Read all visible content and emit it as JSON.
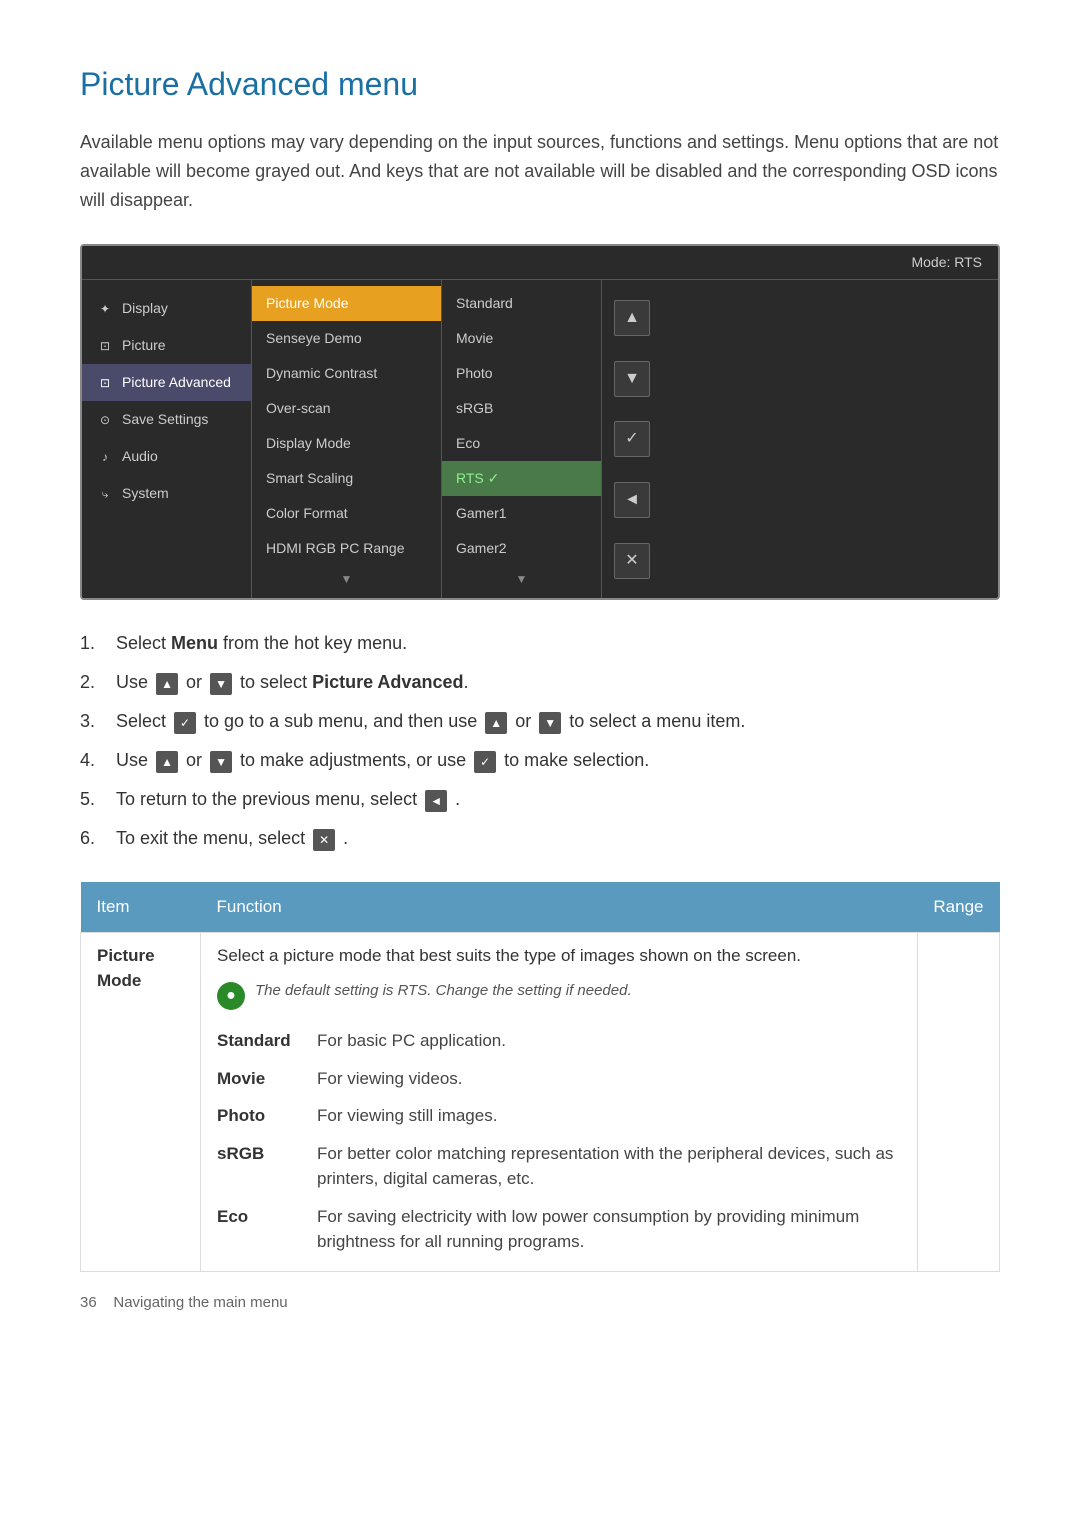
{
  "page": {
    "title": "Picture Advanced menu",
    "intro": "Available menu options may vary depending on the input sources, functions and settings. Menu options that are not available will become grayed out. And keys that are not available will be disabled and the corresponding OSD icons will disappear."
  },
  "osd": {
    "mode_label": "Mode: RTS",
    "sidebar_items": [
      {
        "label": "Display",
        "icon": "✦",
        "active": false
      },
      {
        "label": "Picture",
        "icon": "⊡",
        "active": false
      },
      {
        "label": "Picture Advanced",
        "icon": "⊡",
        "active": true
      },
      {
        "label": "Save Settings",
        "icon": "⊙",
        "active": false
      },
      {
        "label": "Audio",
        "icon": "♪",
        "active": false
      },
      {
        "label": "System",
        "icon": "⤷",
        "active": false
      }
    ],
    "menu_items": [
      {
        "label": "Picture Mode",
        "highlighted": true
      },
      {
        "label": "Senseye Demo",
        "highlighted": false
      },
      {
        "label": "Dynamic Contrast",
        "highlighted": false
      },
      {
        "label": "Over-scan",
        "highlighted": false
      },
      {
        "label": "Display Mode",
        "highlighted": false
      },
      {
        "label": "Smart Scaling",
        "highlighted": false
      },
      {
        "label": "Color Format",
        "highlighted": false
      },
      {
        "label": "HDMI RGB PC Range",
        "highlighted": false
      }
    ],
    "value_items": [
      {
        "label": "Standard",
        "selected": false
      },
      {
        "label": "Movie",
        "selected": false
      },
      {
        "label": "Photo",
        "selected": false
      },
      {
        "label": "sRGB",
        "selected": false
      },
      {
        "label": "Eco",
        "selected": false
      },
      {
        "label": "RTS ✓",
        "selected": true
      },
      {
        "label": "Gamer1",
        "selected": false
      },
      {
        "label": "Gamer2",
        "selected": false
      }
    ],
    "controls": [
      "▲",
      "▼",
      "✓",
      "◄",
      "✕"
    ],
    "scroll_down": "▼"
  },
  "instructions": [
    {
      "step": "1.",
      "text_before": "Select ",
      "bold": "Menu",
      "text_after": " from the hot key menu.",
      "icons": []
    },
    {
      "step": "2.",
      "text_before": "Use",
      "text_middle": "or",
      "text_after": "to select ",
      "bold": "Picture Advanced",
      "has_icons": true
    },
    {
      "step": "3.",
      "text_before": "Select",
      "text_middle": "to go to a sub menu, and then use",
      "text_or": "or",
      "text_after": "to select a menu item.",
      "has_icons": true
    },
    {
      "step": "4.",
      "text_before": "Use",
      "text_middle": "or",
      "text_after": "to make adjustments, or use",
      "text_end": "to make selection.",
      "has_icons": true
    },
    {
      "step": "5.",
      "text_before": "To return to the previous menu, select",
      "text_after": ".",
      "has_icon": true
    },
    {
      "step": "6.",
      "text_before": "To exit the menu, select",
      "text_after": ".",
      "has_icon": true
    }
  ],
  "table": {
    "headers": [
      "Item",
      "Function",
      "Range"
    ],
    "rows": [
      {
        "item": "Picture Mode",
        "description": "Select a picture mode that best suits the type of images shown on the screen.",
        "note": "The default setting is RTS. Change the setting if needed.",
        "sub_items": [
          {
            "name": "Standard",
            "desc": "For basic PC application."
          },
          {
            "name": "Movie",
            "desc": "For viewing videos."
          },
          {
            "name": "Photo",
            "desc": "For viewing still images."
          },
          {
            "name": "sRGB",
            "desc": "For better color matching representation with the peripheral devices, such as printers, digital cameras, etc."
          },
          {
            "name": "Eco",
            "desc": "For saving electricity with low power consumption by providing minimum brightness for all running programs."
          }
        ],
        "range": ""
      }
    ]
  },
  "footer": {
    "page_num": "36",
    "page_label": "Navigating the main menu"
  }
}
